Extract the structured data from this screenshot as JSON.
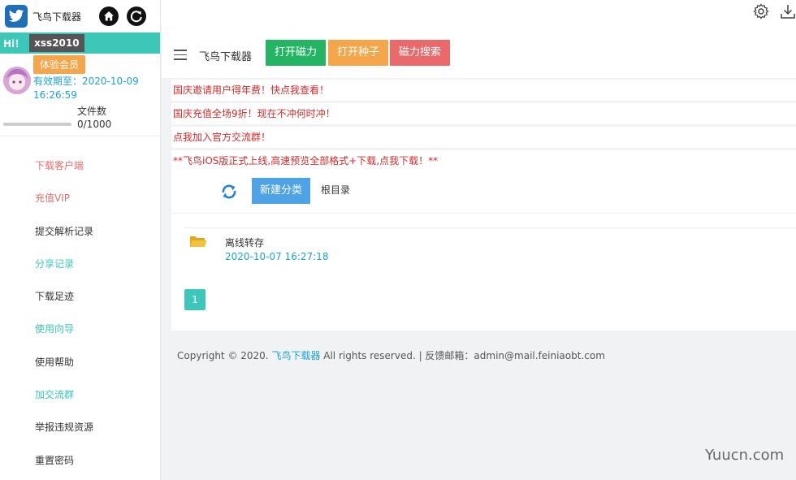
{
  "sidebar": {
    "app_name": "飞鸟下载器",
    "hi": "Hi！",
    "username": "xss2010",
    "member_badge": "体验会员",
    "expire": "有效期至：2020-10-09 16:26:59",
    "file_label": "文件数",
    "file_count": "0/1000",
    "file_progress_fraction": 0,
    "menu": [
      {
        "label": "下载客户端",
        "color": "red"
      },
      {
        "label": "充值VIP",
        "color": "red"
      },
      {
        "label": "提交解析记录",
        "color": "dark"
      },
      {
        "label": "分享记录",
        "color": "teal"
      },
      {
        "label": "下载足迹",
        "color": "dark"
      },
      {
        "label": "使用向导",
        "color": "teal"
      },
      {
        "label": "使用帮助",
        "color": "dark"
      },
      {
        "label": "加交流群",
        "color": "teal"
      },
      {
        "label": "举报违规资源",
        "color": "dark"
      },
      {
        "label": "重置密码",
        "color": "dark"
      }
    ]
  },
  "toolbar": {
    "title": "飞鸟下载器",
    "open_magnet": "打开磁力",
    "open_torrent": "打开种子",
    "magnet_search": "磁力搜索"
  },
  "notices": [
    "国庆邀请用户得年费！快点我查看！",
    "国庆充值全场9折！现在不冲何时冲！",
    "点我加入官方交流群！",
    "**飞鸟iOS版正式上线,高速预览全部格式+下载,点我下载！**"
  ],
  "files": {
    "new_category": "新建分类",
    "root_dir": "根目录",
    "items": [
      {
        "name": "离线转存",
        "date": "2020-10-07 16:27:18"
      }
    ],
    "page": "1"
  },
  "footer": {
    "prefix": "Copyright © 2020. ",
    "link": "飞鸟下载器",
    "suffix": " All rights reserved. | 反馈邮箱：admin@mail.feiniaobt.com"
  },
  "watermark": "Yuucn.com",
  "colors": {
    "accent_teal": "#3cc7b8",
    "btn_green": "#23b464",
    "btn_orange": "#f5a54a",
    "btn_red": "#ea6a6b",
    "btn_blue": "#4ea3e6",
    "notice_red": "#d42b2b",
    "link_blue": "#1aa3d9"
  },
  "icons": [
    "bird-logo-icon",
    "home-icon",
    "refresh-icon",
    "gear-icon",
    "download-icon",
    "hamburger-icon",
    "sync-icon",
    "folder-icon"
  ]
}
